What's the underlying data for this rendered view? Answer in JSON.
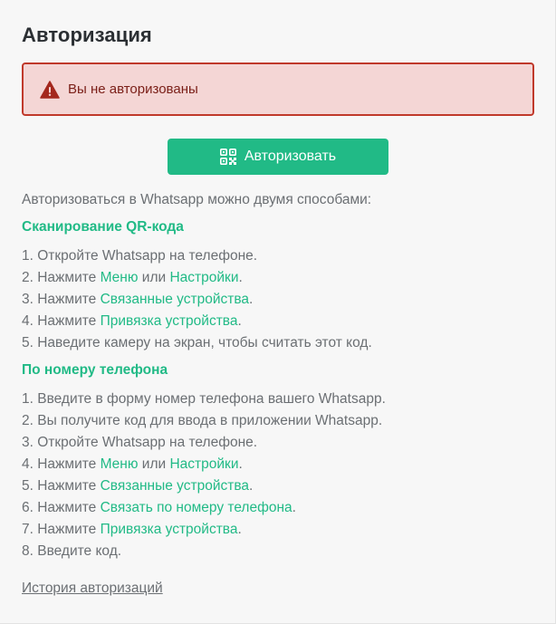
{
  "page": {
    "title": "Авторизация"
  },
  "alert": {
    "icon": "warning-triangle-icon",
    "text": "Вы не авторизованы",
    "color": "#c0392b"
  },
  "auth_button": {
    "icon": "qr-code-icon",
    "label": "Авторизовать",
    "color": "#21ba86"
  },
  "intro": "Авторизоваться в Whatsapp можно двумя способами:",
  "qr_section": {
    "heading": "Сканирование QR-кода",
    "steps": [
      {
        "parts": [
          "1. Откройте Whatsapp на телефоне."
        ]
      },
      {
        "parts": [
          "2. Нажмите ",
          "Меню",
          " или ",
          "Настройки",
          "."
        ]
      },
      {
        "parts": [
          "3. Нажмите ",
          "Связанные устройства",
          "."
        ]
      },
      {
        "parts": [
          "4. Нажмите ",
          "Привязка устройства",
          "."
        ]
      },
      {
        "parts": [
          "5. Наведите камеру на экран, чтобы считать этот код."
        ]
      }
    ]
  },
  "phone_section": {
    "heading": "По номеру телефона",
    "steps": [
      {
        "parts": [
          "1. Введите в форму номер телефона вашего Whatsapp."
        ]
      },
      {
        "parts": [
          "2. Вы получите код для ввода в приложении Whatsapp."
        ]
      },
      {
        "parts": [
          "3. Откройте Whatsapp на телефоне."
        ]
      },
      {
        "parts": [
          "4. Нажмите ",
          "Меню",
          " или ",
          "Настройки",
          "."
        ]
      },
      {
        "parts": [
          "5. Нажмите ",
          "Связанные устройства",
          "."
        ]
      },
      {
        "parts": [
          "6. Нажмите ",
          "Связать по номеру телефона",
          "."
        ]
      },
      {
        "parts": [
          "7. Нажмите ",
          "Привязка устройства",
          "."
        ]
      },
      {
        "parts": [
          "8. Введите код."
        ]
      }
    ]
  },
  "history_link": "История авторизаций",
  "colors": {
    "accent": "#21ba86",
    "danger": "#c0392b",
    "alert_bg": "#f4d6d5",
    "text": "#6b6f73",
    "title": "#2b2f33"
  }
}
